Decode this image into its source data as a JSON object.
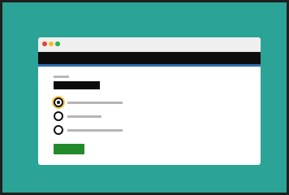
{
  "colors": {
    "background": "#2ba497",
    "frame": "#1f1f1f",
    "window": "#ffffff",
    "titlebar": "#efefef",
    "navbar": "#0c0c0c",
    "accent": "#2f6fb3",
    "submit": "#238a2b",
    "traffic_lights": [
      "#e0433a",
      "#f2bd2c",
      "#2bb24c"
    ],
    "focus_ring": "#f2c94c",
    "placeholder_text": "#b6b6b6"
  },
  "window_controls": [
    {
      "icon": "close-dot-icon"
    },
    {
      "icon": "minimize-dot-icon"
    },
    {
      "icon": "maximize-dot-icon"
    }
  ],
  "form": {
    "selected_option_index": 0,
    "focused_option_index": 0
  }
}
